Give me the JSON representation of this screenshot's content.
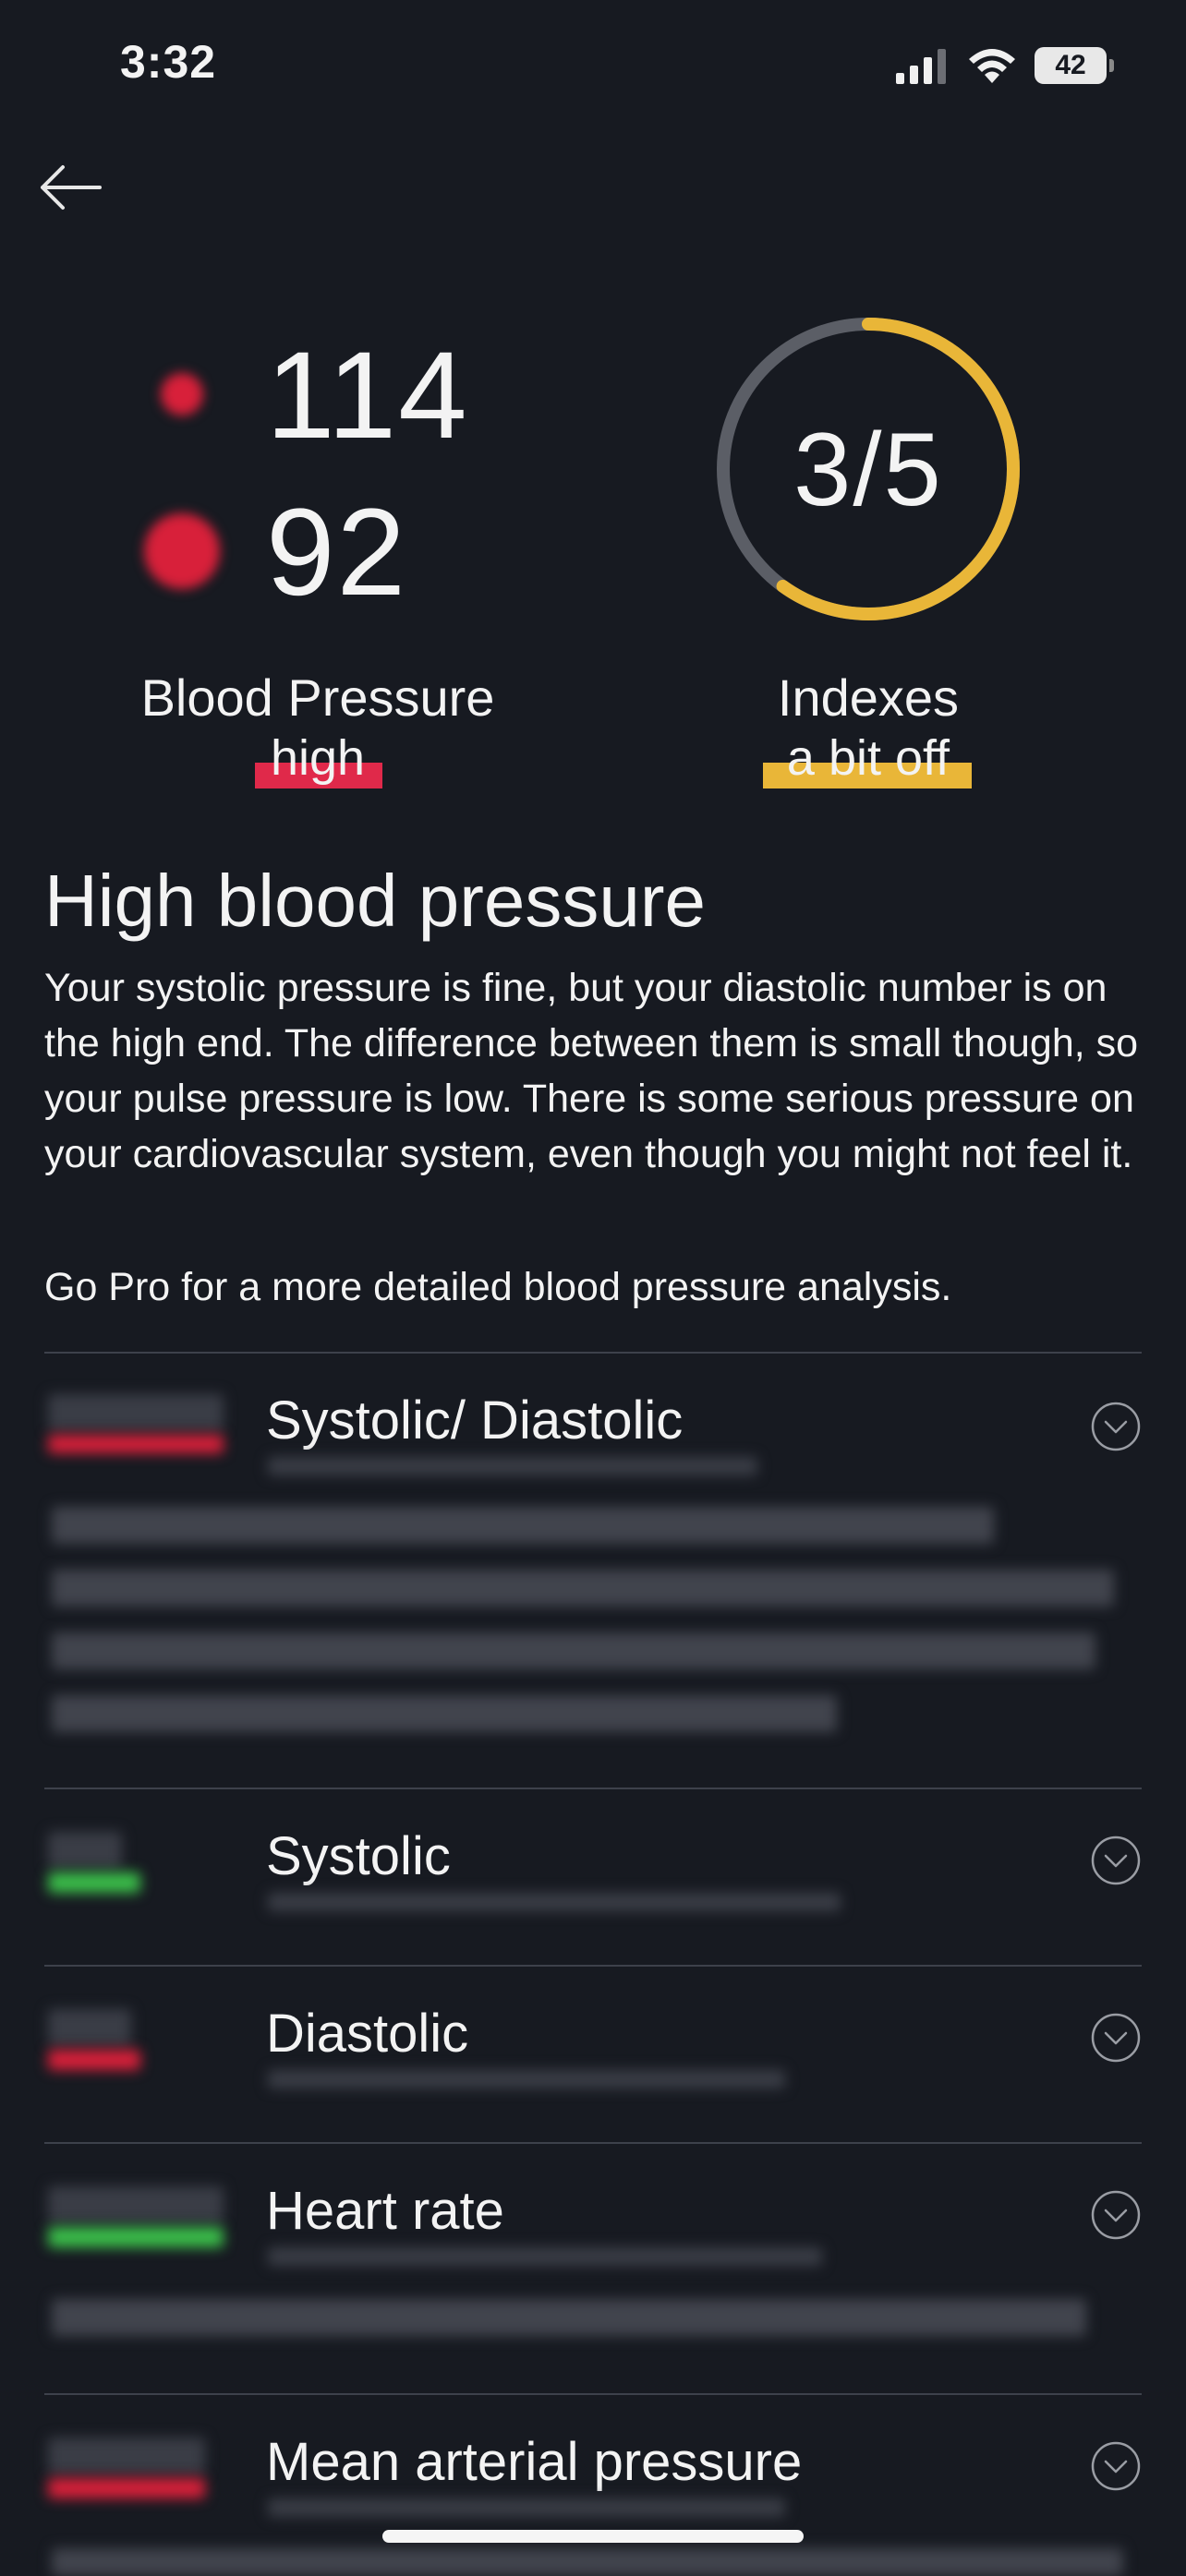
{
  "status_bar": {
    "time": "3:32",
    "battery": "42"
  },
  "bp": {
    "systolic": "114",
    "diastolic": "92",
    "label": "Blood Pressure",
    "status": "high",
    "status_color": "#e0294a"
  },
  "indexes": {
    "value_text": "3/5",
    "fraction": 0.6,
    "label": "Indexes",
    "status": "a bit off",
    "status_color": "#e9b638"
  },
  "summary": {
    "title": "High blood pressure",
    "body": "Your systolic pressure is fine, but your diastolic number is on the high end. The difference between them is small though, so your pulse pressure is low. There is some serious pressure on your cardiovascular system, even though you might not feel it.",
    "pro_note": "Go Pro for a more detailed blood pressure analysis."
  },
  "rows": [
    {
      "title": "Systolic/ Diastolic",
      "badge_color": "#d8203a"
    },
    {
      "title": "Systolic",
      "badge_color": "#3bbf4a"
    },
    {
      "title": "Diastolic",
      "badge_color": "#d8203a"
    },
    {
      "title": "Heart rate",
      "badge_color": "#3bbf4a"
    },
    {
      "title": "Mean arterial pressure",
      "badge_color": "#d8203a"
    }
  ],
  "colors": {
    "background": "#171a21",
    "ring_track": "#5b5e66",
    "ring_fill": "#e9b638",
    "red": "#d8203a",
    "green": "#3bbf4a"
  }
}
